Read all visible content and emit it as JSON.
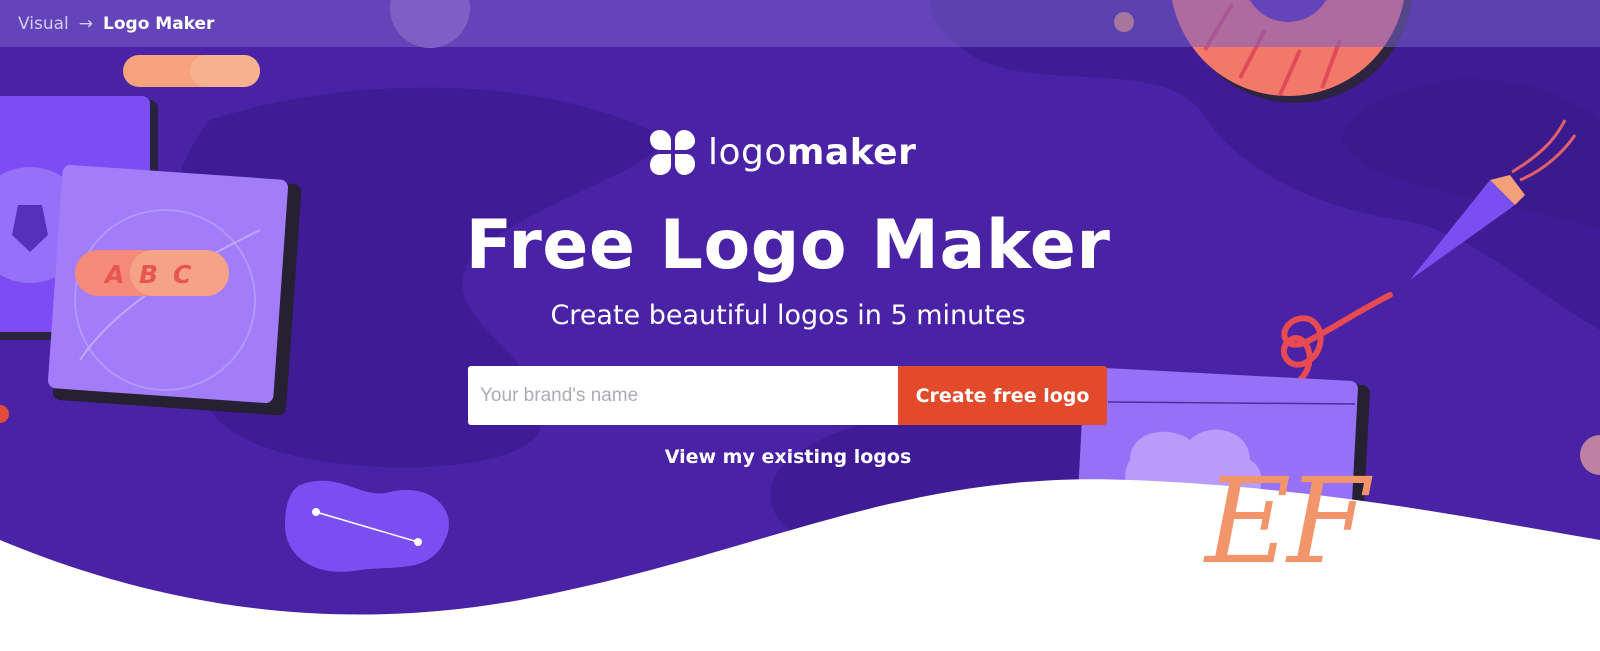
{
  "breadcrumb": {
    "parent": "Visual",
    "separator": "→",
    "current": "Logo Maker"
  },
  "brand": {
    "name_light": "logo",
    "name_bold": "maker",
    "icon": "logomaker-icon"
  },
  "hero": {
    "title": "Free Logo Maker",
    "subtitle": "Create beautiful logos in 5 minutes",
    "view_link": "View my existing logos"
  },
  "form": {
    "placeholder": "Your brand's name",
    "value": "",
    "button_label": "Create free logo"
  },
  "illustration": {
    "abc_letters": [
      "A",
      "B",
      "C"
    ],
    "ef_letters": "EF"
  },
  "colors": {
    "hero_bg": "#4a22a6",
    "hero_dark_blob": "#3f1c96",
    "accent_orange": "#e24a2b",
    "salmon": "#f57a6a",
    "peach": "#f5a47d",
    "lavender": "#9a73f5"
  }
}
